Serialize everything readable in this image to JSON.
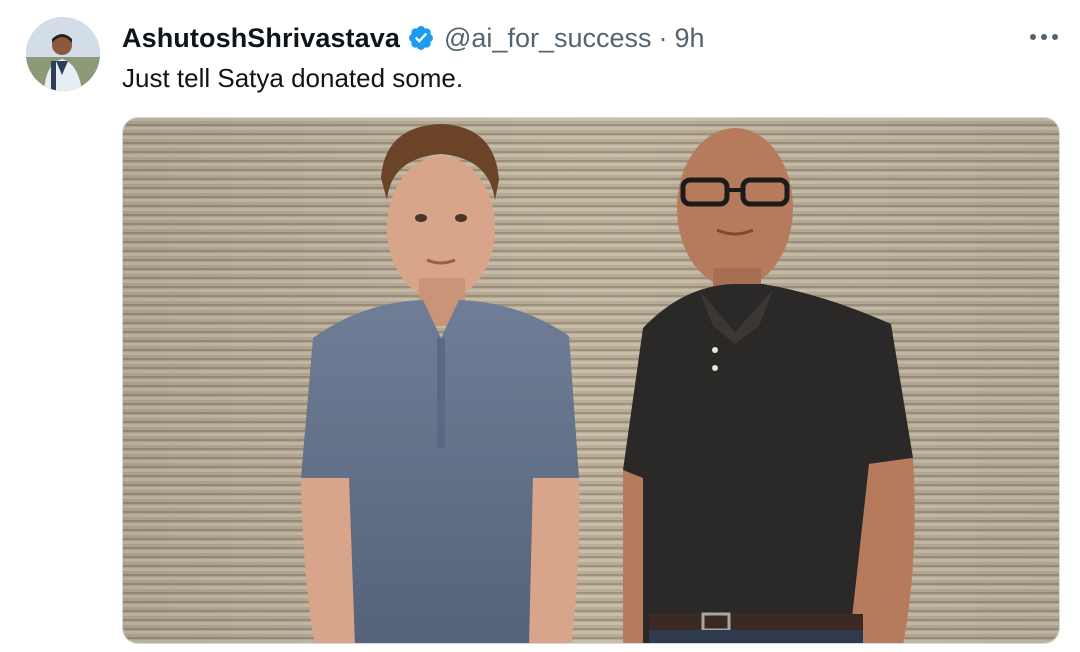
{
  "tweet": {
    "author": {
      "display_name": "AshutoshShrivastava",
      "handle": "@ai_for_success",
      "verified_icon": "verified-badge-icon",
      "avatar_icon": "user-avatar"
    },
    "separator": "·",
    "time": "9h",
    "more_icon": "more-horizontal-icon",
    "text": "Just tell Satya donated some.",
    "media": {
      "type": "photo"
    }
  },
  "colors": {
    "text_primary": "#0f1419",
    "text_secondary": "#536471",
    "verified_blue": "#1d9bf0",
    "wall": "#b7ab96"
  }
}
